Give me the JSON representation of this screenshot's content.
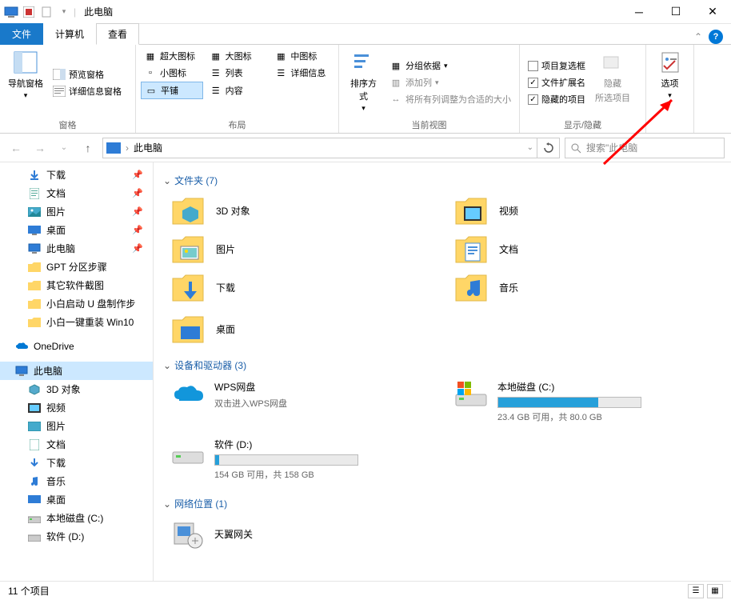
{
  "title": "此电脑",
  "tabs": {
    "file": "文件",
    "computer": "计算机",
    "view": "查看"
  },
  "ribbon": {
    "panes": {
      "nav_pane": "导航窗格",
      "preview_pane": "预览窗格",
      "details_pane": "详细信息窗格",
      "label": "窗格"
    },
    "layout": {
      "extra_large": "超大图标",
      "large": "大图标",
      "medium": "中图标",
      "small": "小图标",
      "list": "列表",
      "details": "详细信息",
      "tiles": "平铺",
      "content": "内容",
      "label": "布局"
    },
    "current_view": {
      "sort": "排序方式",
      "group_by": "分组依据",
      "add_columns": "添加列",
      "fit_columns": "将所有列调整为合适的大小",
      "label": "当前视图"
    },
    "show_hide": {
      "checkboxes": "项目复选框",
      "extensions": "文件扩展名",
      "hidden_items": "隐藏的项目",
      "hide_selected": "隐藏所选项目",
      "hide_selected_line1": "隐藏",
      "hide_selected_line2": "所选项目",
      "label": "显示/隐藏"
    },
    "options": "选项"
  },
  "address": {
    "location": "此电脑",
    "refresh": "↻"
  },
  "search": {
    "placeholder": "搜索\"此电脑"
  },
  "sidebar": {
    "downloads": "下载",
    "documents": "文档",
    "pictures": "图片",
    "desktop": "桌面",
    "this_pc": "此电脑",
    "gpt_partition": "GPT 分区步骤",
    "other_screenshots": "其它软件截图",
    "xiaobai_usb": "小白启动 U 盘制作步",
    "xiaobai_reinstall": "小白一键重装 Win10",
    "onedrive": "OneDrive",
    "this_pc_main": "此电脑",
    "3d": "3D 对象",
    "videos": "视频",
    "pictures2": "图片",
    "documents2": "文档",
    "downloads2": "下载",
    "music": "音乐",
    "desktop2": "桌面",
    "disk_c": "本地磁盘 (C:)",
    "disk_d": "软件 (D:)"
  },
  "content": {
    "folders_header": "文件夹 (7)",
    "folders": {
      "3d": "3D 对象",
      "videos": "视频",
      "pictures": "图片",
      "documents": "文档",
      "downloads": "下载",
      "music": "音乐",
      "desktop": "桌面"
    },
    "drives_header": "设备和驱动器 (3)",
    "drives": {
      "wps": {
        "name": "WPS网盘",
        "sub": "双击进入WPS网盘"
      },
      "c": {
        "name": "本地磁盘 (C:)",
        "sub": "23.4 GB 可用，共 80.0 GB",
        "fill": 70
      },
      "d": {
        "name": "软件 (D:)",
        "sub": "154 GB 可用，共 158 GB",
        "fill": 3
      }
    },
    "network_header": "网络位置 (1)",
    "network": {
      "gateway": "天翼网关"
    }
  },
  "status": {
    "count": "11 个项目"
  }
}
